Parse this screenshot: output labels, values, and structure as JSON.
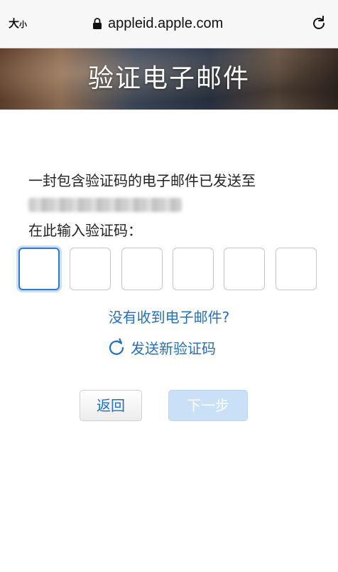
{
  "browser": {
    "text_size_large": "大",
    "text_size_small": "小",
    "url": "appleid.apple.com"
  },
  "header": {
    "title": "验证电子邮件"
  },
  "main": {
    "info_text": "一封包含验证码的电子邮件已发送至",
    "enter_code_label": "在此输入验证码：",
    "code_digits": [
      "",
      "",
      "",
      "",
      "",
      ""
    ],
    "no_email_link": "没有收到电子邮件?",
    "resend_link": "发送新验证码"
  },
  "actions": {
    "back_label": "返回",
    "next_label": "下一步"
  },
  "colors": {
    "link": "#1f6fc5",
    "active_border": "#2a7bd5",
    "next_disabled_bg": "#c9e0f7"
  },
  "icons": {
    "lock": "lock-icon",
    "reload": "reload-icon",
    "resend": "refresh-icon"
  }
}
